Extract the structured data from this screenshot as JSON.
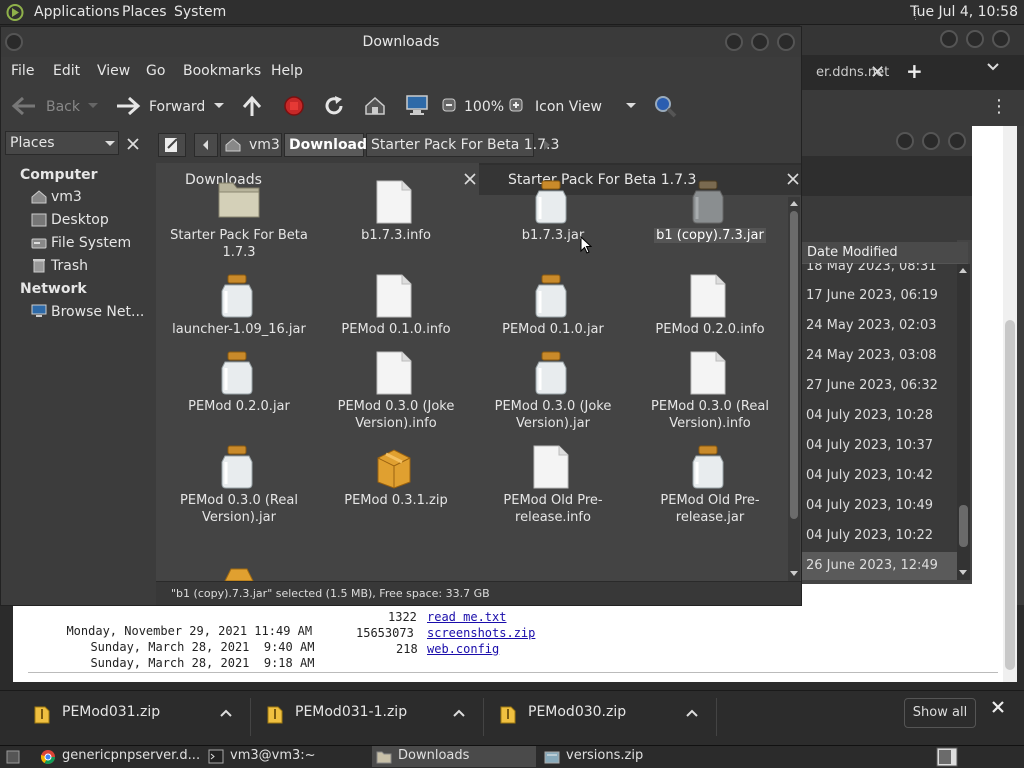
{
  "top_panel": {
    "menus": [
      "Applications",
      "Places",
      "System"
    ],
    "clock": "Tue Jul 4, 10:58"
  },
  "chrome": {
    "tab_label": "er.ddns.net",
    "tab_close": "✕",
    "new_tab": "+",
    "menu": "⋮"
  },
  "page": {
    "rows": [
      {
        "date": "Monday, November 29, 2021 11:49 AM",
        "size": "1322",
        "name": "read me.txt"
      },
      {
        "date": "Sunday, March 28, 2021  9:40 AM",
        "size": "15653073",
        "name": "screenshots.zip"
      },
      {
        "date": "Sunday, March 28, 2021  9:18 AM",
        "size": "218",
        "name": "web.config"
      }
    ]
  },
  "inner_window": {
    "column_header": "Date Modified",
    "dates": [
      "18 May 2023, 08:31",
      "17 June 2023, 06:19",
      "24 May 2023, 02:03",
      "24 May 2023, 03:08",
      "27 June 2023, 06:32",
      "04 July 2023, 10:28",
      "04 July 2023, 10:37",
      "04 July 2023, 10:42",
      "04 July 2023, 10:49",
      "04 July 2023, 10:22",
      "26 June 2023, 12:49"
    ]
  },
  "file_manager": {
    "title": "Downloads",
    "menus": [
      "File",
      "Edit",
      "View",
      "Go",
      "Bookmarks",
      "Help"
    ],
    "toolbar": {
      "back": "Back",
      "forward": "Forward",
      "zoom": "100%",
      "view_mode": "Icon View"
    },
    "sidebar": {
      "selector": "Places",
      "computer_header": "Computer",
      "computer_items": [
        "vm3",
        "Desktop",
        "File System",
        "Trash"
      ],
      "network_header": "Network",
      "network_items": [
        "Browse Net..."
      ]
    },
    "path": [
      "vm3",
      "Downloads",
      "Starter Pack For Beta 1.7.3"
    ],
    "tabs": [
      "Downloads",
      "Starter Pack For Beta 1.7.3"
    ],
    "files": [
      {
        "name": "Starter Pack For Beta 1.7.3",
        "type": "folder"
      },
      {
        "name": "b1.7.3.info",
        "type": "doc"
      },
      {
        "name": "b1.7.3.jar",
        "type": "jar"
      },
      {
        "name": "b1 (copy).7.3.jar",
        "type": "jar-gray",
        "selected": true
      },
      {
        "name": "launcher-1.09_16.jar",
        "type": "jar"
      },
      {
        "name": "PEMod 0.1.0.info",
        "type": "doc"
      },
      {
        "name": "PEMod 0.1.0.jar",
        "type": "jar"
      },
      {
        "name": "PEMod 0.2.0.info",
        "type": "doc"
      },
      {
        "name": "PEMod 0.2.0.jar",
        "type": "jar"
      },
      {
        "name": "PEMod 0.3.0 (Joke Version).info",
        "type": "doc"
      },
      {
        "name": "PEMod 0.3.0 (Joke Version).jar",
        "type": "jar"
      },
      {
        "name": "PEMod 0.3.0 (Real Version).info",
        "type": "doc"
      },
      {
        "name": "PEMod 0.3.0 (Real Version).jar",
        "type": "jar"
      },
      {
        "name": "PEMod 0.3.1.zip",
        "type": "zip"
      },
      {
        "name": "PEMod Old Pre-release.info",
        "type": "doc"
      },
      {
        "name": "PEMod Old Pre-release.jar",
        "type": "jar"
      }
    ],
    "status": "\"b1 (copy).7.3.jar\" selected (1.5 MB), Free space: 33.7 GB"
  },
  "downloads_bar": {
    "items": [
      "PEMod031.zip",
      "PEMod031-1.zip",
      "PEMod030.zip"
    ],
    "show_all": "Show all"
  },
  "taskbar": {
    "items": [
      "genericpnpserver.d...",
      "vm3@vm3:~",
      "Downloads",
      "versions.zip"
    ]
  }
}
